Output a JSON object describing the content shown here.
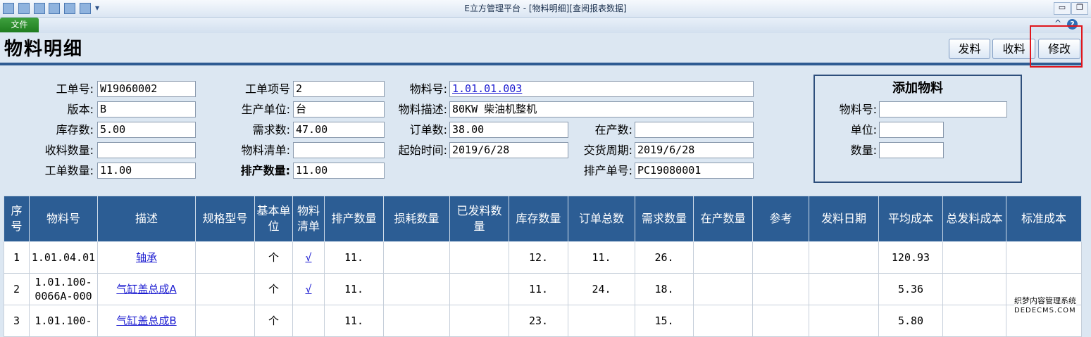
{
  "window": {
    "title": "E立方管理平台 - [物料明细][查阅报表数据]",
    "minimize": "▭",
    "restore": "❐"
  },
  "ribbon": {
    "file_tab": "文件",
    "collapse": "^",
    "help": "?"
  },
  "page": {
    "title": "物料明细"
  },
  "actions": {
    "issue": "发料",
    "receive": "收料",
    "modify": "修改"
  },
  "form": {
    "work_order_no": {
      "label": "工单号:",
      "value": "W19060002"
    },
    "version": {
      "label": "版本:",
      "value": "B"
    },
    "stock_qty": {
      "label": "库存数:",
      "value": "5.00"
    },
    "received_qty": {
      "label": "收料数量:",
      "value": ""
    },
    "order_qty": {
      "label": "工单数量:",
      "value": "11.00"
    },
    "item_no": {
      "label": "工单项号",
      "value": "2"
    },
    "unit": {
      "label": "生产单位:",
      "value": "台"
    },
    "demand_qty": {
      "label": "需求数:",
      "value": "47.00"
    },
    "bom": {
      "label": "物料清单:",
      "value": ""
    },
    "scheduled_qty": {
      "label": "排产数量:",
      "value": "11.00"
    },
    "material_no": {
      "label": "物料号:",
      "value": "1.01.01.003"
    },
    "material_desc": {
      "label": "物料描述:",
      "value": "80KW 柴油机整机"
    },
    "ordered_qty": {
      "label": "订单数:",
      "value": "38.00"
    },
    "start_time": {
      "label": "起始时间:",
      "value": "2019/6/28"
    },
    "in_production": {
      "label": "在产数:",
      "value": ""
    },
    "delivery": {
      "label": "交货周期:",
      "value": "2019/6/28"
    },
    "schedule_no": {
      "label": "排产单号:",
      "value": "PC19080001"
    }
  },
  "add_material": {
    "title": "添加物料",
    "material_no_label": "物料号:",
    "unit_label": "单位:",
    "qty_label": "数量:"
  },
  "table": {
    "headers": [
      "序号",
      "物料号",
      "描述",
      "规格型号",
      "基本单位",
      "物料清单",
      "排产数量",
      "损耗数量",
      "已发料数量",
      "库存数量",
      "订单总数",
      "需求数量",
      "在产数量",
      "参考",
      "发料日期",
      "平均成本",
      "总发料成本",
      "标准成本"
    ],
    "rows": [
      {
        "seq": "1",
        "material_no": "1.01.04.01",
        "desc": "轴承",
        "spec": "",
        "unit": "个",
        "bom": "√",
        "scheduled": "11.",
        "loss": "",
        "issued": "",
        "stock": "12.",
        "orders": "11.",
        "demand": "26.",
        "in_prod": "",
        "ref": "",
        "issue_date": "",
        "avg_cost": "120.93",
        "total_cost": "",
        "std_cost": ""
      },
      {
        "seq": "2",
        "material_no": "1.01.100-0066A-000",
        "desc": "气缸盖总成A",
        "spec": "",
        "unit": "个",
        "bom": "√",
        "scheduled": "11.",
        "loss": "",
        "issued": "",
        "stock": "11.",
        "orders": "24.",
        "demand": "18.",
        "in_prod": "",
        "ref": "",
        "issue_date": "",
        "avg_cost": "5.36",
        "total_cost": "",
        "std_cost": ""
      },
      {
        "seq": "3",
        "material_no": "1.01.100-",
        "desc": "气缸盖总成B",
        "spec": "",
        "unit": "个",
        "bom": "",
        "scheduled": "11.",
        "loss": "",
        "issued": "",
        "stock": "23.",
        "orders": "",
        "demand": "15.",
        "in_prod": "",
        "ref": "",
        "issue_date": "",
        "avg_cost": "5.80",
        "total_cost": "",
        "std_cost": ""
      }
    ]
  },
  "watermark": {
    "line1": "织梦内容管理系统",
    "line2": "DEDECMS.COM"
  }
}
